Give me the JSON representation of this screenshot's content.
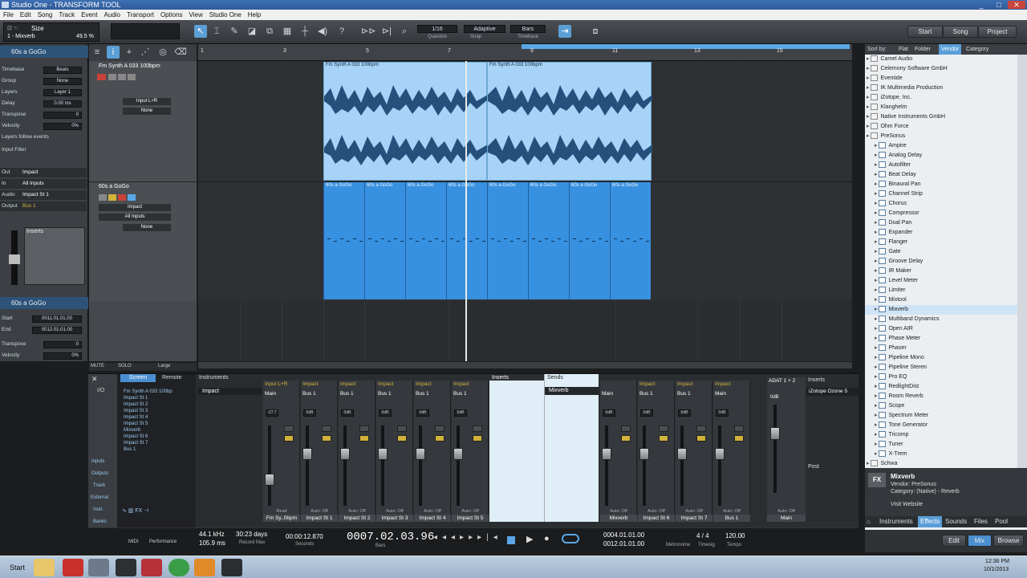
{
  "window": {
    "title": "Studio One - TRANSFORM TOOL",
    "minimize": "_",
    "maximize": "□",
    "close": "✕"
  },
  "menu": [
    "File",
    "Edit",
    "Song",
    "Track",
    "Event",
    "Audio",
    "Transport",
    "Options",
    "View",
    "Studio One",
    "Help"
  ],
  "toolbar": {
    "size_label": "Size",
    "event_name": "1 - Mixverb",
    "size_value": "49.5 %",
    "quantize_value": "1/16",
    "quantize_label": "Quantize",
    "snap_value": "Adaptive",
    "snap_label": "Snap",
    "timebase_value": "Bars",
    "timebase_label": "Timebase",
    "nav": {
      "start": "Start",
      "song": "Song",
      "project": "Project"
    }
  },
  "inspector": {
    "track_header": "60s a GoGo",
    "rows": [
      {
        "label": "Timebase",
        "value": "Beats"
      },
      {
        "label": "Group",
        "value": "None"
      },
      {
        "label": "Layers",
        "value": "Layer 1"
      },
      {
        "label": "Delay",
        "value": "0.00 ms"
      },
      {
        "label": "Transpose",
        "value": "0"
      },
      {
        "label": "Velocity",
        "value": "0%"
      }
    ],
    "layers_follow": "Layers follow events",
    "input_filter": "Input Filter",
    "routing": [
      {
        "label": "Out",
        "value": "Impact"
      },
      {
        "label": "In",
        "value": "All Inputs"
      },
      {
        "label": "Audio",
        "value": "Impact St 1"
      },
      {
        "label": "Output",
        "value": "Bus 1"
      }
    ],
    "inserts_label": "Inserts",
    "event_header": "60s a GoGo",
    "event_rows": [
      {
        "label": "Start",
        "value": "0011.01.01.00"
      },
      {
        "label": "End",
        "value": "0012.01.01.00"
      },
      {
        "label": "Transpose",
        "value": "0"
      },
      {
        "label": "Velocity",
        "value": "0%"
      }
    ]
  },
  "tracks": [
    {
      "name": "Fm Synth A 033 100bpm",
      "input": "Input L+R",
      "output": "None"
    },
    {
      "name": "60s a GoGo",
      "instrument": "Impact",
      "input": "All Inputs",
      "output": "None"
    }
  ],
  "ruler": {
    "marks": [
      "1",
      "3",
      "5",
      "7",
      "9",
      "11",
      "13",
      "15"
    ]
  },
  "events": {
    "audio1": "Fm Synth A 033 100bpm",
    "audio2": "Fm Synth A 033 100bpm",
    "midi_name": "60s a GoGo"
  },
  "arrange_footer": {
    "mute": "MUTE",
    "solo": "SOLO",
    "size": "Large"
  },
  "browser": {
    "sort_label": "Sort by:",
    "sort_options": [
      "Flat",
      "Folder",
      "Vendor",
      "Category"
    ],
    "vendors_top": [
      "Camel Audio",
      "Celemony Software GmbH",
      "Eventide",
      "IK Multimedia Production",
      "iZotope, Inc.",
      "Klanghelm",
      "Native Instruments GmbH",
      "Ohm Force",
      "PreSonus"
    ],
    "plugins": [
      "Ampire",
      "Analog Delay",
      "Autofilter",
      "Beat Delay",
      "Binaural Pan",
      "Channel Strip",
      "Chorus",
      "Compressor",
      "Dual Pan",
      "Expander",
      "Flanger",
      "Gate",
      "Groove Delay",
      "IR Maker",
      "Level Meter",
      "Limiter",
      "Mixtool",
      "Mixverb",
      "Multiband Dynamics",
      "Open AIR",
      "Phase Meter",
      "Phaser",
      "Pipeline Mono",
      "Pipeline Stereo",
      "Pro EQ",
      "RedlightDist",
      "Room Reverb",
      "Scope",
      "Spectrum Meter",
      "Tone Generator",
      "Tricomp",
      "Tuner",
      "X-Trem"
    ],
    "vendors_bottom": [
      "Schwa"
    ],
    "selected": "Mixverb",
    "info": {
      "name": "Mixverb",
      "vendor": "Vendor:   PreSonus",
      "category": "Category:  (Native) - Reverb",
      "link": "Visit Website"
    },
    "tabs": [
      "Instruments",
      "Effects",
      "Sounds",
      "Files",
      "Pool"
    ],
    "view_buttons": [
      "Edit",
      "Mix",
      "Browse"
    ]
  },
  "mixer": {
    "tabs": [
      "Screen",
      "Remote"
    ],
    "io_label": "I/O",
    "instruments_label": "Instruments",
    "impact_label": "Impact",
    "channel_list": [
      "Fm Synth A 033 100bp",
      "Impact St 1",
      "Impact St 2",
      "Impact St 3",
      "Impact St 4",
      "Impact St 5",
      "Mixverb",
      "Impact St 6",
      "Impact St 7",
      "Bus 1"
    ],
    "side_buttons": [
      "Inputs",
      "Outputs",
      "Trash",
      "External",
      "Instr.",
      "Banks"
    ],
    "strips": [
      {
        "top": "Input L+R",
        "io": "Main",
        "db": "-27.7",
        "auto": "Read",
        "name": "Fm Sy..0bpm"
      },
      {
        "top": "Impact",
        "io": "Bus 1",
        "db": "0dB",
        "auto": "Auto: Off",
        "name": "Impact St 1"
      },
      {
        "top": "Impact",
        "io": "Bus 1",
        "db": "0dB",
        "auto": "Auto: Off",
        "name": "Impact St 2"
      },
      {
        "top": "Impact",
        "io": "Bus 1",
        "db": "0dB",
        "auto": "Auto: Off",
        "name": "Impact St 3"
      },
      {
        "top": "Impact",
        "io": "Bus 1",
        "db": "0dB",
        "auto": "Auto: Off",
        "name": "Impact St 4"
      },
      {
        "top": "Impact",
        "io": "Bus 1",
        "db": "0dB",
        "auto": "Auto: Off",
        "name": "Impact St 5"
      }
    ],
    "inserts_label": "Inserts",
    "sends_label": "Sends",
    "send_item": "Mixverb",
    "strips2": [
      {
        "top": "",
        "io": "Main",
        "db": "0dB",
        "auto": "Auto: Off",
        "name": "Mixverb"
      },
      {
        "top": "Impact",
        "io": "Bus 1",
        "db": "0dB",
        "auto": "Auto: Off",
        "name": "Impact St 6"
      },
      {
        "top": "Impact",
        "io": "Bus 1",
        "db": "0dB",
        "auto": "Auto: Off",
        "name": "Impact St 7"
      },
      {
        "top": "Impact",
        "io": "Main",
        "db": "0dB",
        "auto": "Auto: Off",
        "name": "Bus 1"
      }
    ],
    "main": {
      "top": "ADAT 1 + 2",
      "db": "0dB",
      "auto": "Auto: Off",
      "name": "Main",
      "inserts": "Inserts",
      "plugin": "iZotope Ozone 5",
      "post": "Post"
    }
  },
  "transport": {
    "midi": "MIDI",
    "performance": "Performance",
    "rate": "44.1 kHz",
    "latency": "105.9 ms",
    "record_days": "30:23 days",
    "record_max": "Record Max",
    "seconds": "00:00:12.870",
    "seconds_label": "Seconds",
    "bars": "0007.02.03.96",
    "bars_label": "Bars",
    "loop_start": "0004.01.01.00",
    "loop_end": "0012.01.01.00",
    "metronome": "Metronome",
    "timesig": "4 / 4",
    "timesig_label": "Timesig",
    "tempo": "120.00",
    "tempo_label": "Tempo"
  },
  "taskbar": {
    "start": "Start",
    "time": "12:36 PM",
    "date": "10/1/2013"
  }
}
